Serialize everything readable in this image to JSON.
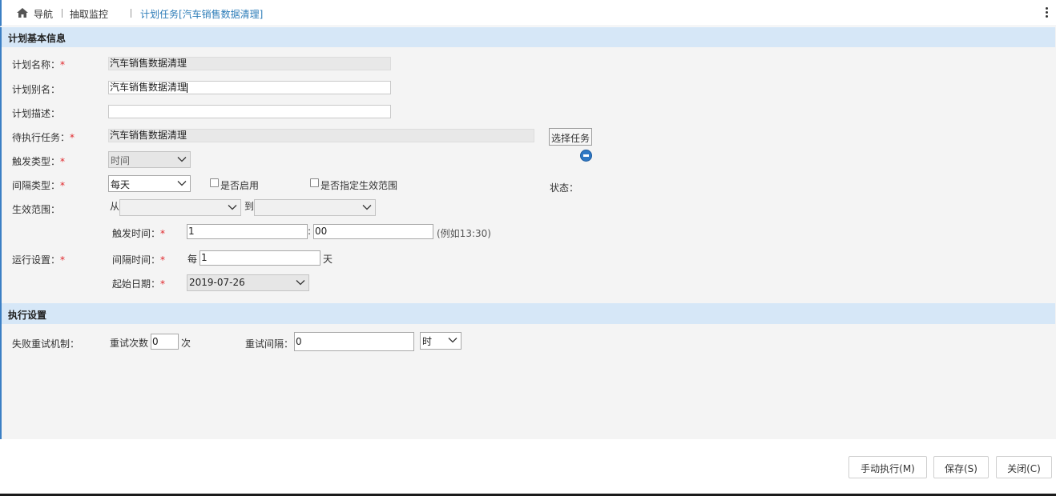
{
  "breadcrumb": {
    "home_label": "导航",
    "item_1": "抽取监控",
    "item_2": "计划任务[汽车销售数据清理]"
  },
  "section_basic": {
    "title": "计划基本信息",
    "plan_name_label": "计划名称：",
    "plan_name_value": "汽车销售数据清理",
    "plan_alias_label": "计划别名：",
    "plan_alias_value": "汽车销售数据清理",
    "plan_desc_label": "计划描述：",
    "plan_desc_value": "",
    "pending_task_label": "待执行任务：",
    "pending_task_value": "汽车销售数据清理",
    "choose_task_button": "选择任务",
    "trigger_type_label": "触发类型：",
    "trigger_type_value": "时间",
    "interval_type_label": "间隔类型：",
    "interval_type_value": "每天",
    "enable_label": "是否启用",
    "specify_range_label": "是否指定生效范围",
    "status_label": "状态：",
    "effective_range_label": "生效范围：",
    "from_label": "从",
    "to_label": "到",
    "from_value": "",
    "to_value": "",
    "trigger_time_label": "触发时间：",
    "trigger_hour": "1",
    "time_colon": ":",
    "trigger_minute": "00",
    "trigger_time_hint": "(例如13:30)",
    "run_settings_label": "运行设置：",
    "interval_time_label": "间隔时间：",
    "every_label": "每",
    "interval_value": "1",
    "day_unit": "天",
    "start_date_label": "起始日期：",
    "start_date_value": "2019-07-26",
    "required_mark": "*"
  },
  "section_exec": {
    "title": "执行设置",
    "retry_mechanism_label": "失败重试机制：",
    "retry_count_label": "重试次数",
    "retry_count_value": "0",
    "retry_count_unit": "次",
    "retry_interval_label": "重试间隔：",
    "retry_interval_value": "0",
    "retry_interval_unit": "时"
  },
  "footer": {
    "manual_run_button": "手动执行(M)",
    "save_button": "保存(S)",
    "close_button": "关闭(C)"
  },
  "colors": {
    "section_header_bg": "#d6e7f7",
    "required_red": "#e0262b",
    "active_crumb": "#2c7cb8",
    "status_icon": "#2f78c4"
  }
}
